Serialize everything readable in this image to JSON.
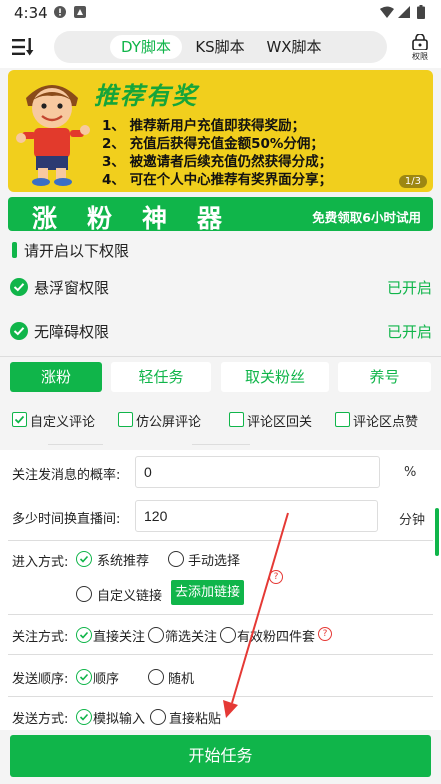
{
  "status_bar": {
    "time": "4:34"
  },
  "header": {
    "tabs": [
      {
        "label": "DY脚本",
        "active": true
      },
      {
        "label": "KS脚本",
        "active": false
      },
      {
        "label": "WX脚本",
        "active": false
      }
    ],
    "perm_label": "权限"
  },
  "banner": {
    "title": "推荐有奖",
    "lines": [
      "1、 推荐新用户充值即获得奖励；",
      "2、 充值后获得充值金额50%分佣；",
      "3、 被邀请者后续充值仍然获得分成；",
      "4、 可在个人中心推荐有奖界面分享；"
    ],
    "pager": "1/3"
  },
  "strip": {
    "title": "涨粉神器",
    "subtitle": "免费领取6小时试用"
  },
  "permissions": {
    "heading": "请开启以下权限",
    "items": [
      {
        "label": "悬浮窗权限",
        "status": "已开启"
      },
      {
        "label": "无障碍权限",
        "status": "已开启"
      }
    ]
  },
  "action_tabs": [
    {
      "label": "涨粉",
      "active": true
    },
    {
      "label": "轻任务",
      "active": false
    },
    {
      "label": "取关粉丝",
      "active": false
    },
    {
      "label": "养号",
      "active": false
    }
  ],
  "options": [
    {
      "label": "自定义评论",
      "checked": true
    },
    {
      "label": "仿公屏评论",
      "checked": false
    },
    {
      "label": "评论区回关",
      "checked": false
    },
    {
      "label": "评论区点赞",
      "checked": false
    }
  ],
  "form": {
    "follow_prob": {
      "label": "关注发消息的概率:",
      "value": "0",
      "unit": "%"
    },
    "switch_interval": {
      "label": "多少时间换直播间:",
      "value": "120",
      "unit": "分钟"
    },
    "entry_mode": {
      "label": "进入方式:",
      "options": [
        "系统推荐",
        "手动选择",
        "自定义链接"
      ],
      "selected": "系统推荐",
      "add_link_button": "去添加链接"
    },
    "follow_mode": {
      "label": "关注方式:",
      "options": [
        "直接关注",
        "筛选关注",
        "有效粉四件套"
      ],
      "selected": "直接关注"
    },
    "send_order": {
      "label": "发送顺序:",
      "options": [
        "顺序",
        "随机"
      ],
      "selected": "顺序"
    },
    "send_mode": {
      "label": "发送方式:",
      "options": [
        "模拟输入",
        "直接粘贴"
      ],
      "selected": "模拟输入"
    }
  },
  "start_button": "开始任务",
  "colors": {
    "accent": "#10b54a",
    "banner": "#f1cf1d",
    "warning": "#e53935"
  }
}
